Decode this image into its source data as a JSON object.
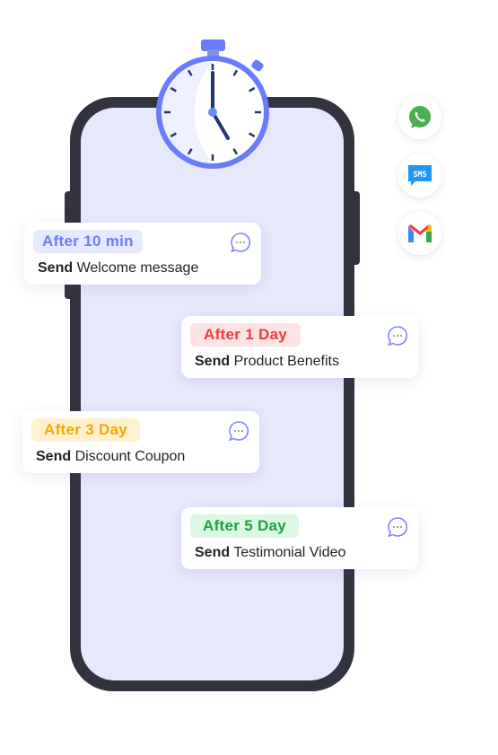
{
  "cards": [
    {
      "badge": "After 10 min",
      "verb": "Send",
      "text": "Welcome message",
      "color": "#6b7bff",
      "bg": "#e6e9ff"
    },
    {
      "badge": "After 1 Day",
      "verb": "Send",
      "text": "Product Benefits",
      "color": "#f23b3b",
      "bg": "#fde3e3"
    },
    {
      "badge": "After 3 Day",
      "verb": "Send",
      "text": "Discount Coupon",
      "color": "#f5a800",
      "bg": "#fff1cf"
    },
    {
      "badge": "After 5 Day",
      "verb": "Send",
      "text": "Testimonial Video",
      "color": "#1aa33f",
      "bg": "#dcf7e3"
    }
  ],
  "channels": [
    {
      "icon": "whatsapp-icon"
    },
    {
      "icon": "sms-icon",
      "label": "SMS"
    },
    {
      "icon": "gmail-icon"
    }
  ]
}
